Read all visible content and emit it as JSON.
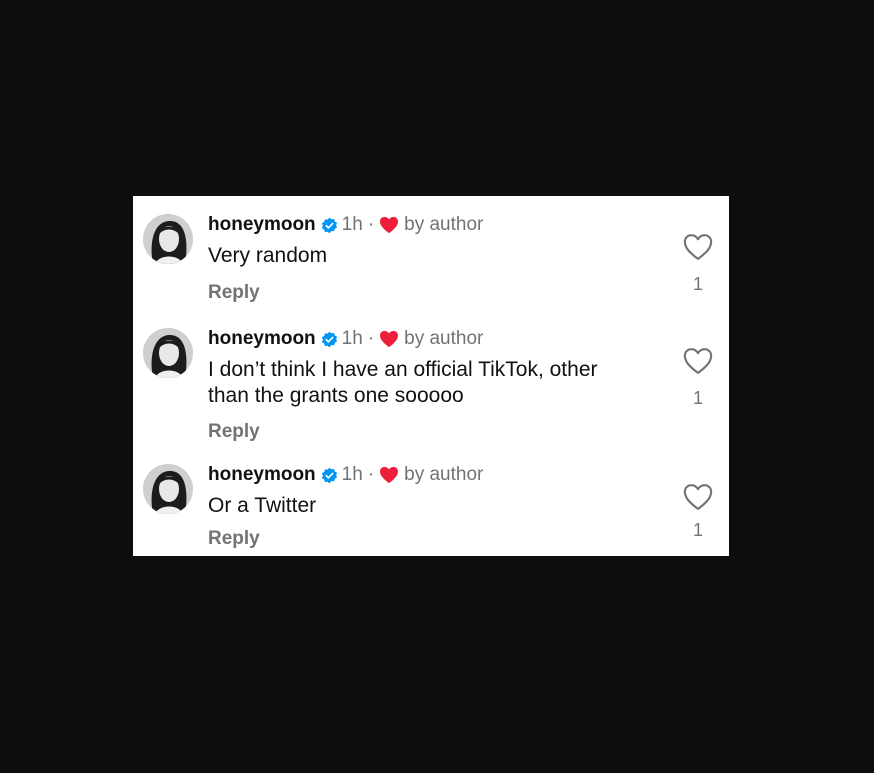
{
  "comments": [
    {
      "username": "honeymoon",
      "time": "1h",
      "separator": "·",
      "liked_by": "by author",
      "text": "Very random",
      "reply_label": "Reply",
      "like_count": "1"
    },
    {
      "username": "honeymoon",
      "time": "1h",
      "separator": "·",
      "liked_by": "by author",
      "text_line1": "I don’t think I have an official TikTok, other",
      "text_line2": "than the grants one sooooo",
      "reply_label": "Reply",
      "like_count": "1"
    },
    {
      "username": "honeymoon",
      "time": "1h",
      "separator": "·",
      "liked_by": "by author",
      "text": "Or a Twitter",
      "reply_label": "Reply",
      "like_count": "1"
    }
  ],
  "icons": {
    "verified": "verified-badge-icon",
    "author_like": "red-heart-icon",
    "like": "heart-outline-icon"
  },
  "colors": {
    "verified": "#0095f6",
    "heart": "#ed1f3a",
    "muted": "#737373",
    "text": "#111111"
  }
}
